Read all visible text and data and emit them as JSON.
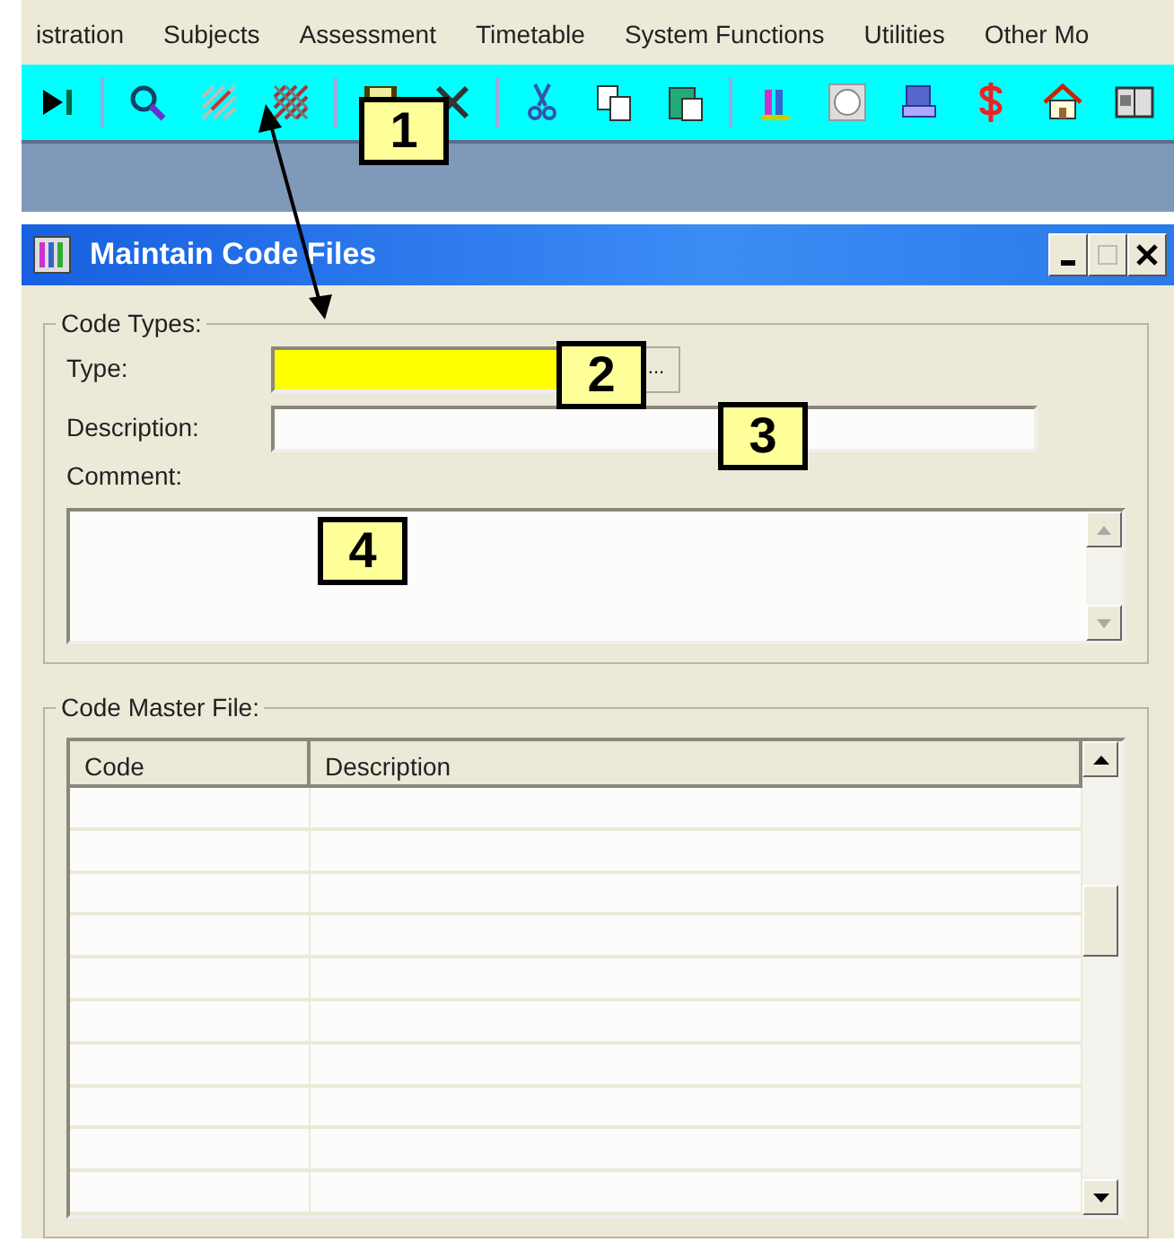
{
  "menu": [
    "istration",
    "Subjects",
    "Assessment",
    "Timetable",
    "System Functions",
    "Utilities",
    "Other Mo"
  ],
  "window": {
    "title": "Maintain Code Files"
  },
  "code_types": {
    "legend": "Code Types:",
    "type": {
      "label": "Type:",
      "highlighted": true,
      "browse": "..."
    },
    "description": {
      "label": "Description:"
    },
    "comment": {
      "label": "Comment:"
    }
  },
  "code_master_file": {
    "legend": "Code Master File:",
    "columns": [
      "Code",
      "Description"
    ]
  },
  "callouts": [
    {
      "text": "1"
    },
    {
      "text": "2"
    },
    {
      "text": "3"
    },
    {
      "text": "4"
    }
  ]
}
